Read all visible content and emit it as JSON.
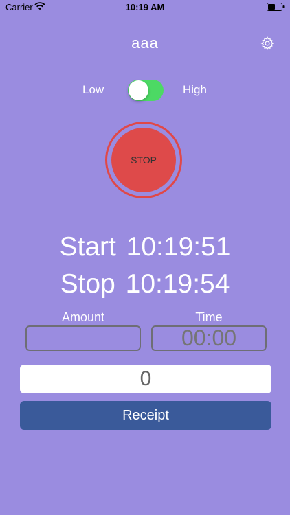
{
  "status_bar": {
    "carrier": "Carrier",
    "time": "10:19 AM"
  },
  "header": {
    "title": "aaa",
    "settings_icon": "gear-icon"
  },
  "mode_toggle": {
    "low_label": "Low",
    "high_label": "High",
    "on": true
  },
  "stop_button": {
    "label": "STOP"
  },
  "times": {
    "start": "Start 10:19:51",
    "stop": "Stop 10:19:54"
  },
  "form": {
    "amount_label": "Amount",
    "amount_value": "",
    "time_label": "Time",
    "time_placeholder": "00:00"
  },
  "total": {
    "value": "0"
  },
  "receipt_button": {
    "label": "Receipt"
  },
  "colors": {
    "background": "#9a8ce0",
    "toggle_on": "#4cd964",
    "stop_red": "#de4a4a",
    "receipt_blue": "#3a5a9a"
  }
}
